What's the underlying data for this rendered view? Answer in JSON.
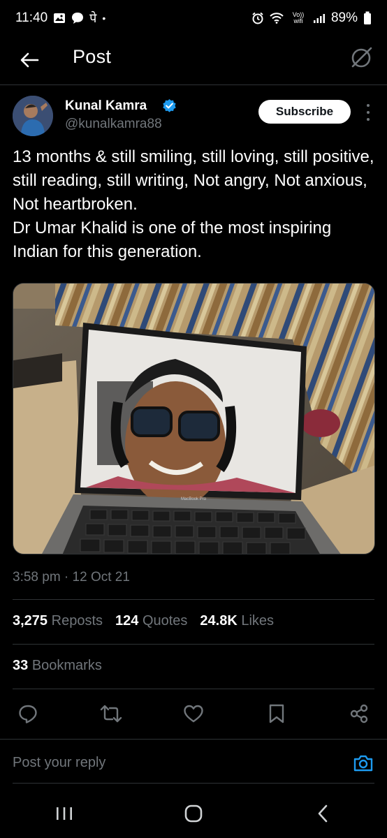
{
  "status_bar": {
    "time": "11:40",
    "notif_letter": "पे",
    "dot": "•",
    "network_small": "Vo)) wifi",
    "battery": "89%"
  },
  "header": {
    "title": "Post"
  },
  "author": {
    "name": "Kunal Kamra",
    "handle": "@kunalkamra88",
    "subscribe_label": "Subscribe"
  },
  "post": {
    "text": "13 months & still smiling, still loving, still positive, still reading, still writing, Not angry, Not anxious, Not heartbroken.\nDr Umar Khalid is one of the most inspiring Indian for this generation.",
    "timestamp": "3:58 pm · 12 Oct 21"
  },
  "stats": {
    "reposts": {
      "count": "3,275",
      "label": "Reposts"
    },
    "quotes": {
      "count": "124",
      "label": "Quotes"
    },
    "likes": {
      "count": "24.8K",
      "label": "Likes"
    },
    "bookmarks": {
      "count": "33",
      "label": "Bookmarks"
    }
  },
  "reply": {
    "placeholder": "Post your reply"
  },
  "media": {
    "laptop_label": "MacBook Pro"
  },
  "colors": {
    "accent": "#1d9bf0",
    "muted": "#71767b",
    "border": "#2f3336"
  },
  "icons": [
    "back-arrow-icon",
    "grok-icon",
    "verified-badge-icon",
    "more-vert-icon",
    "reply-icon",
    "repost-icon",
    "like-icon",
    "bookmark-icon",
    "share-icon",
    "camera-icon",
    "recents-icon",
    "home-icon",
    "back-nav-icon"
  ]
}
